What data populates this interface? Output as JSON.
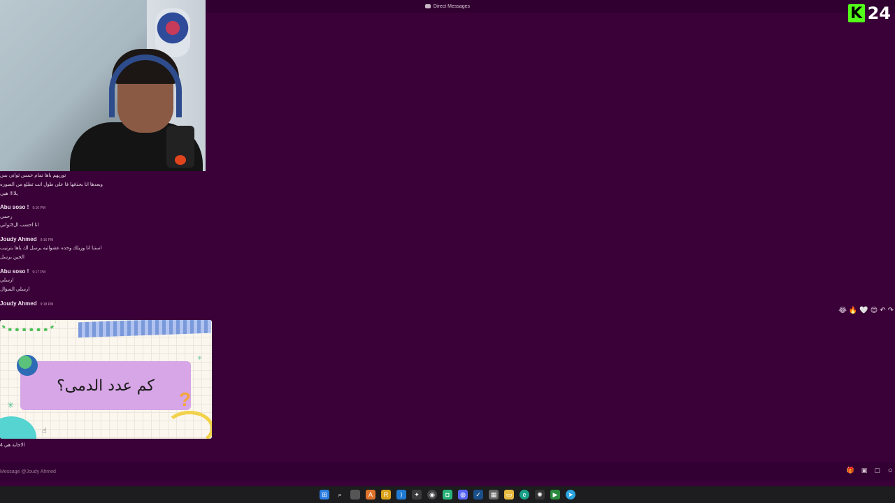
{
  "titlebar": {
    "title": "Direct Messages"
  },
  "overlay": {
    "kick_letter": "K",
    "kick_number": "24"
  },
  "chat": {
    "continuation_lines": [
      "توريهم ياها تمام خمس ثواني بس",
      "وبعدها انا بحذفها فا على طول انت تطلع من الصوره",
      "يلا!!! هيي"
    ],
    "messages": [
      {
        "author": "Abu soso !",
        "time": "9:16 PM",
        "lines": [
          "رحمي",
          "انا احسب ال3ثواني"
        ]
      },
      {
        "author": "Joudy Ahmed",
        "time": "9:16 PM",
        "lines": [
          "استنا انا وزيلك وحده عشوائيه يرسل لك ياها بترتيب",
          "الحين برسل"
        ]
      },
      {
        "author": "Abu soso !",
        "time": "9:17 PM",
        "lines": [
          "ارسلي",
          "ارسلي السؤال"
        ]
      },
      {
        "author": "Joudy Ahmed",
        "time": "9:18 PM",
        "lines": []
      }
    ],
    "attachment": {
      "question_text": "كم عدد الدمى؟",
      "question_mark": "?"
    },
    "answer_line": "الاجابة هي 4"
  },
  "reactions": [
    "😂",
    "🔥",
    "🤍",
    "😍",
    "↶",
    "↷"
  ],
  "composer": {
    "placeholder": "Message @Joudy Ahmed"
  },
  "taskbar": {
    "icons": [
      "windows-start-icon",
      "search-icon",
      "task-view-icon",
      "app-a-icon",
      "app-r-icon",
      "vscode-icon",
      "app-tool-icon",
      "obs-icon",
      "app-green-icon",
      "discord-icon",
      "steam-icon",
      "calculator-icon",
      "folder-icon",
      "edge-icon",
      "chatgpt-icon",
      "play-icon",
      "telegram-icon"
    ]
  }
}
